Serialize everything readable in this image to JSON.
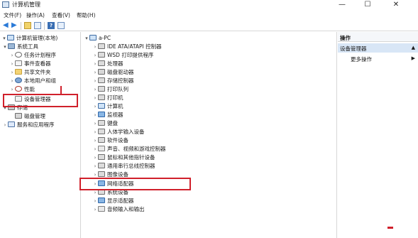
{
  "window": {
    "title": "计算机管理",
    "controls": {
      "minimize": "—",
      "maximize": "☐",
      "close": "✕"
    }
  },
  "menu": [
    "文件(F)",
    "操作(A)",
    "查看(V)",
    "帮助(H)"
  ],
  "tree": [
    {
      "label": "计算机管理(本地)",
      "indent": 0,
      "expander": "▾",
      "icon": "computer-icon"
    },
    {
      "label": "系统工具",
      "indent": 1,
      "expander": "▾",
      "icon": "tools-icon"
    },
    {
      "label": "任务计划程序",
      "indent": 2,
      "expander": "›",
      "icon": "task-scheduler-icon"
    },
    {
      "label": "事件查看器",
      "indent": 2,
      "expander": "›",
      "icon": "event-viewer-icon"
    },
    {
      "label": "共享文件夹",
      "indent": 2,
      "expander": "›",
      "icon": "shared-folder-icon"
    },
    {
      "label": "本地用户和组",
      "indent": 2,
      "expander": "›",
      "icon": "users-icon"
    },
    {
      "label": "性能",
      "indent": 2,
      "expander": "›",
      "icon": "performance-icon"
    },
    {
      "label": "设备管理器",
      "indent": 2,
      "expander": "",
      "icon": "device-manager-icon"
    },
    {
      "label": "存储",
      "indent": 1,
      "expander": "▾",
      "icon": "storage-icon"
    },
    {
      "label": "磁盘管理",
      "indent": 2,
      "expander": "",
      "icon": "disk-icon"
    },
    {
      "label": "服务和应用程序",
      "indent": 1,
      "expander": "›",
      "icon": "services-icon"
    }
  ],
  "devices": {
    "root": "a-PC",
    "items": [
      {
        "label": "IDE ATA/ATAPI 控制器",
        "icon": "ide-controller-icon"
      },
      {
        "label": "WSD 打印提供程序",
        "icon": "printer-icon"
      },
      {
        "label": "处理器",
        "icon": "processor-icon"
      },
      {
        "label": "磁盘驱动器",
        "icon": "disk-drive-icon"
      },
      {
        "label": "存储控制器",
        "icon": "storage-controller-icon"
      },
      {
        "label": "打印队列",
        "icon": "print-queue-icon"
      },
      {
        "label": "打印机",
        "icon": "printer-icon"
      },
      {
        "label": "计算机",
        "icon": "computer-icon"
      },
      {
        "label": "监视器",
        "icon": "monitor-icon"
      },
      {
        "label": "键盘",
        "icon": "keyboard-icon"
      },
      {
        "label": "人体学输入设备",
        "icon": "hid-icon"
      },
      {
        "label": "软件设备",
        "icon": "software-device-icon"
      },
      {
        "label": "声音、视频和游戏控制器",
        "icon": "audio-icon"
      },
      {
        "label": "鼠标和其他指针设备",
        "icon": "mouse-icon"
      },
      {
        "label": "通用串行总线控制器",
        "icon": "usb-icon"
      },
      {
        "label": "图像设备",
        "icon": "camera-icon"
      },
      {
        "label": "网络适配器",
        "icon": "network-adapter-icon"
      },
      {
        "label": "系统设备",
        "icon": "system-device-icon"
      },
      {
        "label": "显示适配器",
        "icon": "display-adapter-icon"
      },
      {
        "label": "音频输入和输出",
        "icon": "audio-io-icon"
      }
    ]
  },
  "actions": {
    "header": "操作",
    "group": "设备管理器",
    "more": "更多操作",
    "caret_up": "▲",
    "caret_right": "▶"
  },
  "colors": {
    "highlight": "#d0202b",
    "selection": "#d8e6f6"
  }
}
